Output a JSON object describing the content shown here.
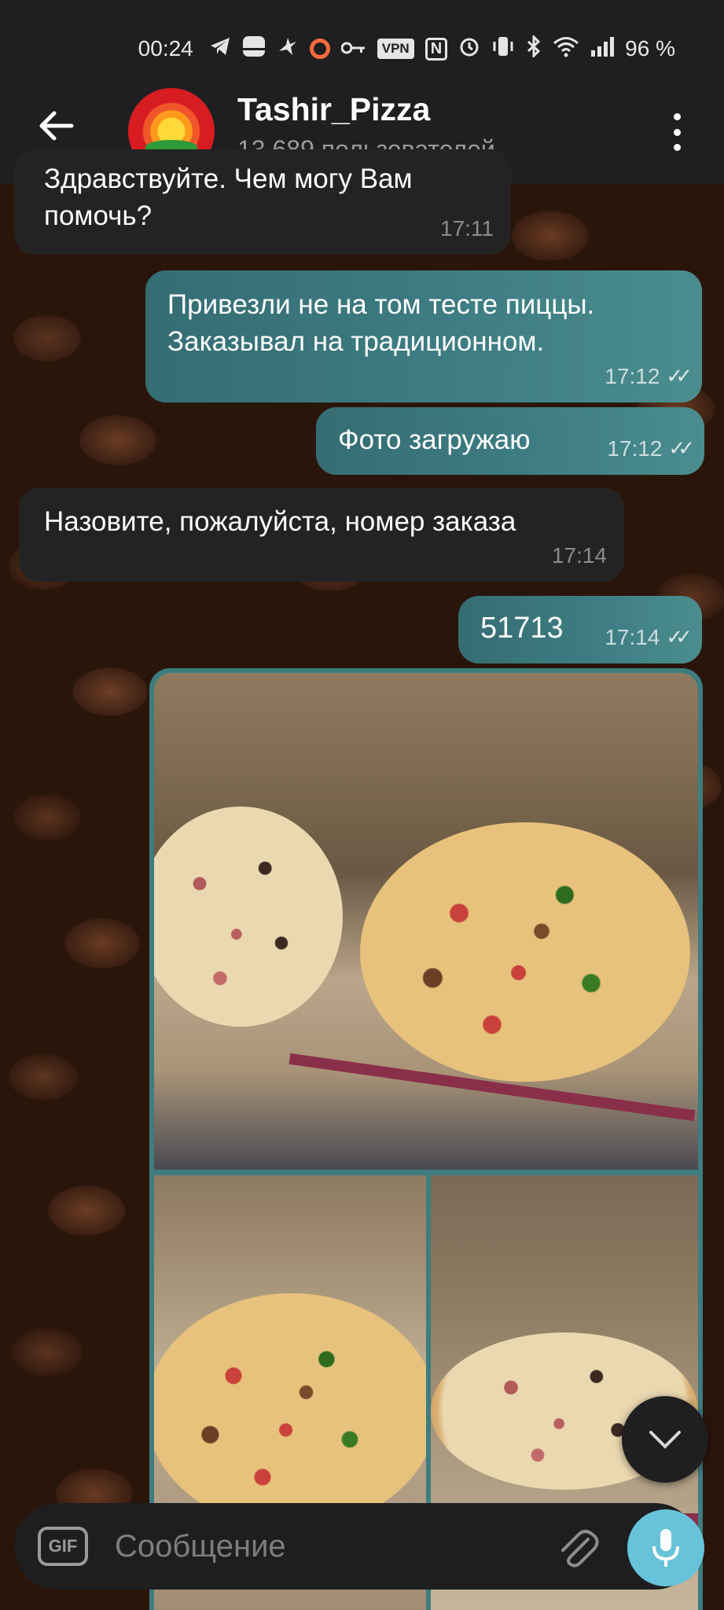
{
  "status_bar": {
    "time": "00:24",
    "vpn_label": "VPN",
    "nfc_label": "N",
    "battery": "96 %"
  },
  "header": {
    "title": "Tashir_Pizza",
    "subtitle": "13,689 пользователей"
  },
  "messages": [
    {
      "direction": "in",
      "text": "Здравствуйте. Чем могу Вам помочь?",
      "time": "17:11"
    },
    {
      "direction": "out",
      "text": "Привезли не на том тесте пиццы. Заказывал на традиционном.",
      "time": "17:12",
      "read": true
    },
    {
      "direction": "out",
      "text": "Фото загружаю",
      "time": "17:12",
      "read": true
    },
    {
      "direction": "in",
      "text": "Назовите, пожалуйста, номер заказа",
      "time": "17:14"
    },
    {
      "direction": "out",
      "text": "51713",
      "time": "17:14",
      "read": true
    }
  ],
  "album": {
    "photos": [
      "pizza-photo",
      "pizza-photo",
      "pizza-photo"
    ]
  },
  "input": {
    "gif_label": "GIF",
    "placeholder": "Сообщение"
  },
  "colors": {
    "outgoing_bubble": "#3e7e84",
    "incoming_bubble": "#232324",
    "mic_button": "#67c3d9"
  },
  "icons": {
    "back": "arrow-left-icon",
    "menu": "more-vertical-icon",
    "scroll": "chevron-down-icon",
    "attach": "paperclip-icon",
    "mic": "microphone-icon"
  }
}
